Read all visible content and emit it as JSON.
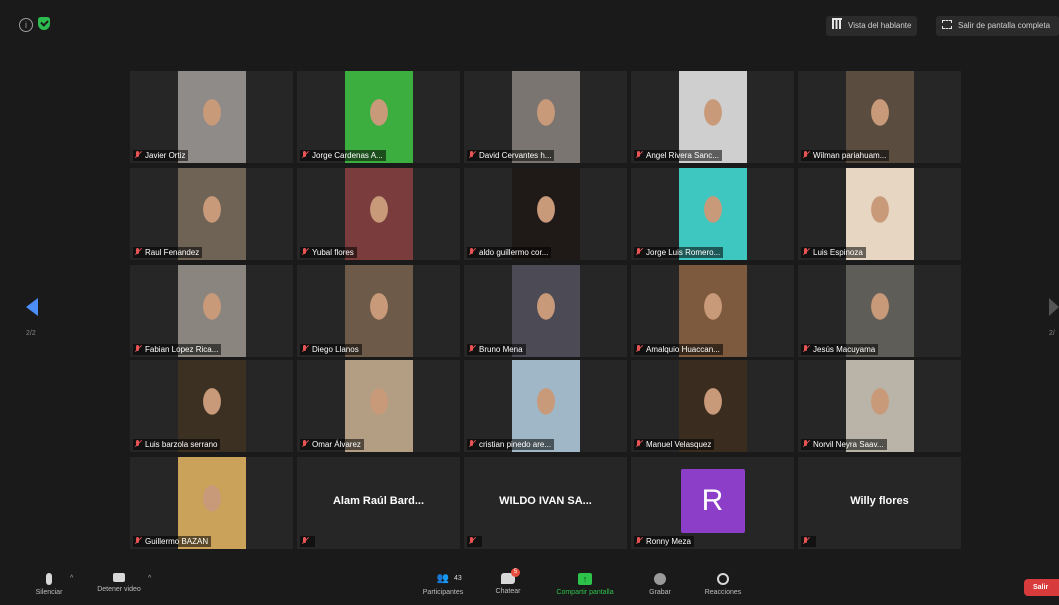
{
  "top_bar": {
    "speaker_view_label": "Vista del hablante",
    "exit_fullscreen_label": "Salir de pantalla completa"
  },
  "pagination": {
    "left_indicator": "2/2",
    "right_indicator": "2/"
  },
  "participants": [
    {
      "name": "Javier Ortiz"
    },
    {
      "name": "Jorge Cardenas A..."
    },
    {
      "name": "David Cervantes h..."
    },
    {
      "name": "Angel Rivera Sanc..."
    },
    {
      "name": "Wilman pariahuam..."
    },
    {
      "name": "Raul Fenandez"
    },
    {
      "name": "Yubal flores"
    },
    {
      "name": "aldo guillermo cor..."
    },
    {
      "name": "Jorge Luis Romero..."
    },
    {
      "name": "Luis Espinoza"
    },
    {
      "name": "Fabian Lopez Rica..."
    },
    {
      "name": "Diego Llanos"
    },
    {
      "name": "Bruno Mena"
    },
    {
      "name": "Amalquio Huaccan..."
    },
    {
      "name": "Jesús Macuyama"
    },
    {
      "name": "Luis barzola serrano"
    },
    {
      "name": "Omar Álvarez"
    },
    {
      "name": "cristian pinedo are..."
    },
    {
      "name": "Manuel Velasquez"
    },
    {
      "name": "Norvil Neyra Saav..."
    },
    {
      "name": "Guillermo BAZAN"
    },
    {
      "name": "",
      "display_name": "Alam Raúl Bard..."
    },
    {
      "name": "",
      "display_name": "WILDO IVAN SA..."
    },
    {
      "name": "Ronny Meza",
      "avatar_letter": "R"
    },
    {
      "name": "",
      "display_name": "Willy flores"
    }
  ],
  "toolbar": {
    "mute_label": "Silenciar",
    "video_label": "Detener video",
    "participants_label": "Participantes",
    "participants_count": "43",
    "chat_label": "Chatear",
    "chat_badge": "5",
    "share_label": "Compartir pantalla",
    "record_label": "Grabar",
    "reactions_label": "Reacciones",
    "leave_label": "Salir"
  },
  "colors": {
    "background": "#1a1a1a",
    "tile": "#262626",
    "share_green": "#2dc24a",
    "leave_red": "#d73b3b",
    "avatar_purple": "#8d3ec8",
    "nav_blue": "#4b8ef7",
    "muted_red": "#e85454"
  }
}
